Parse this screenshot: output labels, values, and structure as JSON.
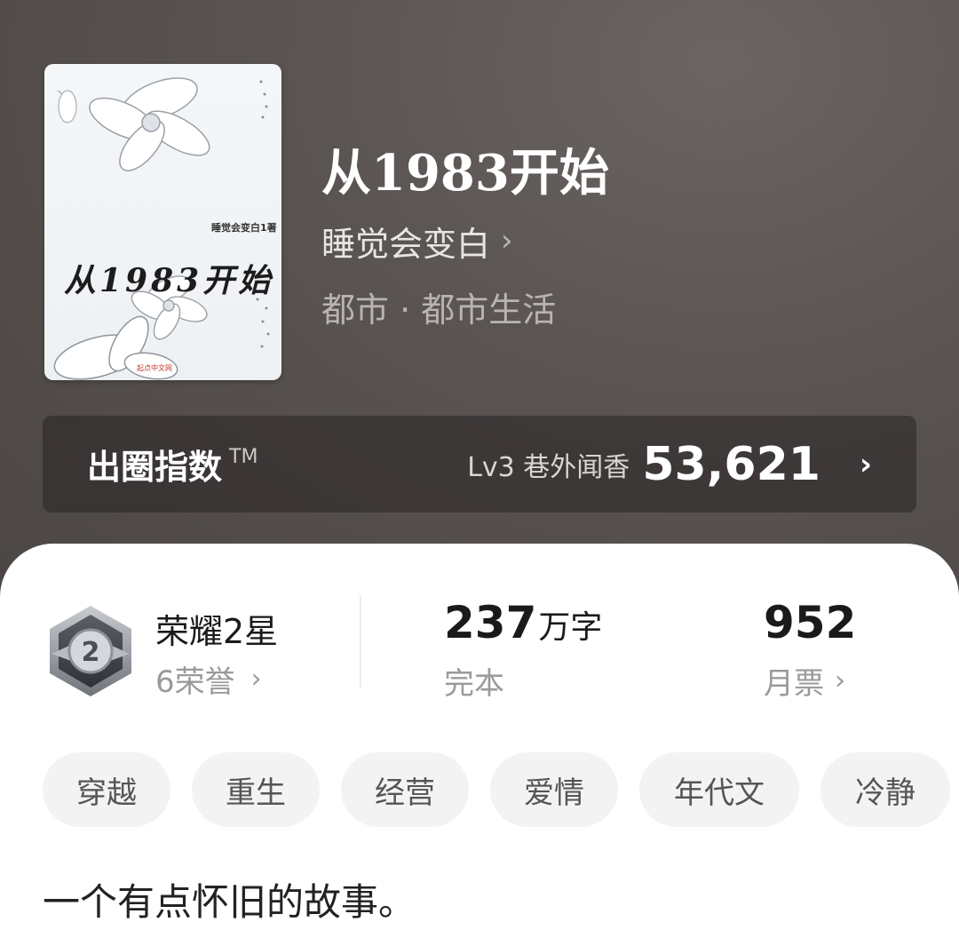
{
  "book": {
    "cover": {
      "title": "从1983开始",
      "author": "睡觉会变白1著",
      "publisher_logo": "起点中文网"
    },
    "title": "从1983开始",
    "author": "睡觉会变白",
    "category": "都市 · 都市生活"
  },
  "index": {
    "label": "出圈指数",
    "trademark": "TM",
    "level": "Lv3 巷外闻香",
    "value": "53,621"
  },
  "stats": {
    "honor_name": "荣耀2星",
    "honor_count": "6荣誉",
    "badge_number": "2",
    "word_count": "237",
    "word_unit": "万字",
    "status": "完本",
    "votes": "952",
    "votes_label": "月票"
  },
  "tags": [
    "穿越",
    "重生",
    "经营",
    "爱情",
    "年代文",
    "冷静"
  ],
  "intro": "一个有点怀旧的故事。",
  "icons": {
    "chevron": "chevron-right-icon",
    "badge": "honor-badge-icon"
  }
}
